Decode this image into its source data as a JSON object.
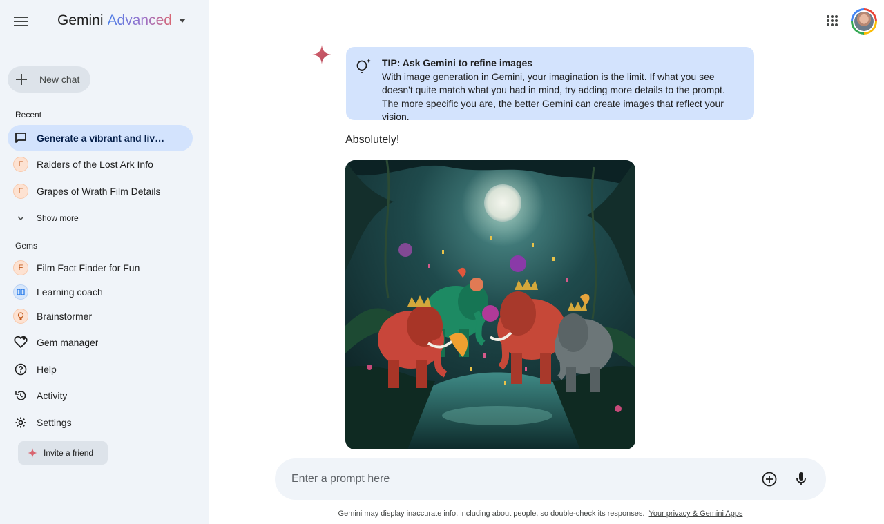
{
  "header": {
    "brand_name": "Gemini",
    "brand_tier": "Advanced"
  },
  "sidebar": {
    "new_chat_label": "New chat",
    "recent_label": "Recent",
    "recent_items": [
      {
        "label": "Generate a vibrant and livel...",
        "icon": "chat-bubble-icon",
        "active": true
      },
      {
        "label": "Raiders of the Lost Ark Info",
        "badge": "F"
      },
      {
        "label": "Grapes of Wrath Film Details",
        "badge": "F"
      }
    ],
    "show_more_label": "Show more",
    "gems_label": "Gems",
    "gems": [
      {
        "label": "Film Fact Finder for Fun",
        "badge": "F"
      },
      {
        "label": "Learning coach",
        "icon": "book-icon"
      },
      {
        "label": "Brainstormer",
        "icon": "lightbulb-icon"
      }
    ],
    "bottom_items": [
      {
        "label": "Gem manager",
        "icon": "gem-heart-icon"
      },
      {
        "label": "Help",
        "icon": "help-icon"
      },
      {
        "label": "Activity",
        "icon": "history-icon"
      },
      {
        "label": "Settings",
        "icon": "gear-icon"
      }
    ],
    "invite_label": "Invite a friend"
  },
  "conversation": {
    "tip_title": "TIP: Ask Gemini to refine images",
    "tip_body": "With image generation in Gemini, your imagination is the limit. If what you see doesn't quite match what you had in mind, try adding more details to the prompt. The more specific you are, the better Gemini can create images that reflect your vision.",
    "response_text": "Absolutely!"
  },
  "prompt": {
    "placeholder": "Enter a prompt here"
  },
  "footer": {
    "disclaimer": "Gemini may display inaccurate info, including about people, so double-check its responses.",
    "privacy_link": "Your privacy & Gemini Apps"
  },
  "colors": {
    "sidebar_bg": "#f0f4f9",
    "active_item_bg": "#d3e3fd",
    "tip_bg": "#d3e3fd",
    "accent_spark": "#d96570"
  }
}
